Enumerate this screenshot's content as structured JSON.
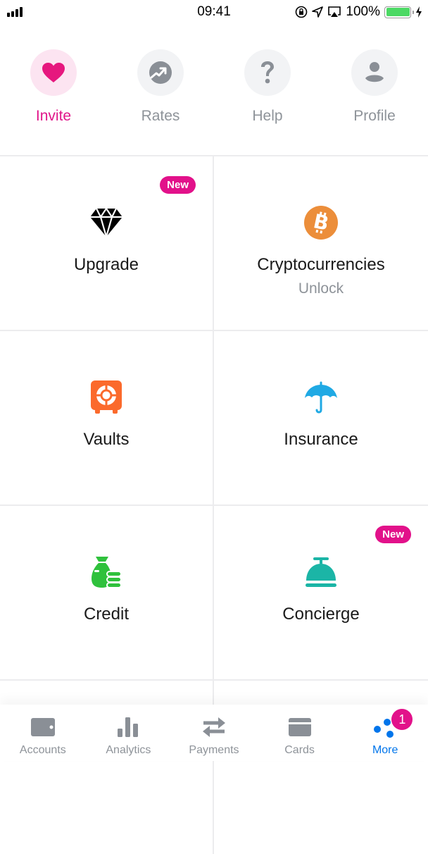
{
  "status_bar": {
    "time": "09:41",
    "battery_percent": "100%",
    "battery_level": 1.0
  },
  "quick_actions": [
    {
      "label": "Invite",
      "icon": "heart-icon",
      "active": true
    },
    {
      "label": "Rates",
      "icon": "trending-up-icon",
      "active": false
    },
    {
      "label": "Help",
      "icon": "question-icon",
      "active": false
    },
    {
      "label": "Profile",
      "icon": "person-icon",
      "active": false
    }
  ],
  "grid": [
    {
      "label": "Upgrade",
      "sub": "",
      "badge": "New",
      "icon": "diamond-icon",
      "color": "#000000"
    },
    {
      "label": "Cryptocurrencies",
      "sub": "Unlock",
      "badge": "",
      "icon": "bitcoin-icon",
      "color": "#ec8e3a"
    },
    {
      "label": "Vaults",
      "sub": "",
      "badge": "",
      "icon": "safe-icon",
      "color": "#fb6a2c"
    },
    {
      "label": "Insurance",
      "sub": "",
      "badge": "",
      "icon": "umbrella-icon",
      "color": "#1fa9e4"
    },
    {
      "label": "Credit",
      "sub": "",
      "badge": "",
      "icon": "money-bag-icon",
      "color": "#2fc13c"
    },
    {
      "label": "Concierge",
      "sub": "",
      "badge": "New",
      "icon": "service-bell-icon",
      "color": "#1bb5a6"
    }
  ],
  "tab_bar": [
    {
      "label": "Accounts",
      "icon": "wallet-icon",
      "active": false
    },
    {
      "label": "Analytics",
      "icon": "bar-chart-icon",
      "active": false
    },
    {
      "label": "Payments",
      "icon": "transfer-arrows-icon",
      "active": false
    },
    {
      "label": "Cards",
      "icon": "card-icon",
      "active": false
    },
    {
      "label": "More",
      "icon": "more-dots-icon",
      "active": true,
      "badge": "1"
    }
  ],
  "colors": {
    "accent_pink": "#e2118a",
    "active_blue": "#0075eb",
    "inactive_gray": "#8e9399"
  }
}
